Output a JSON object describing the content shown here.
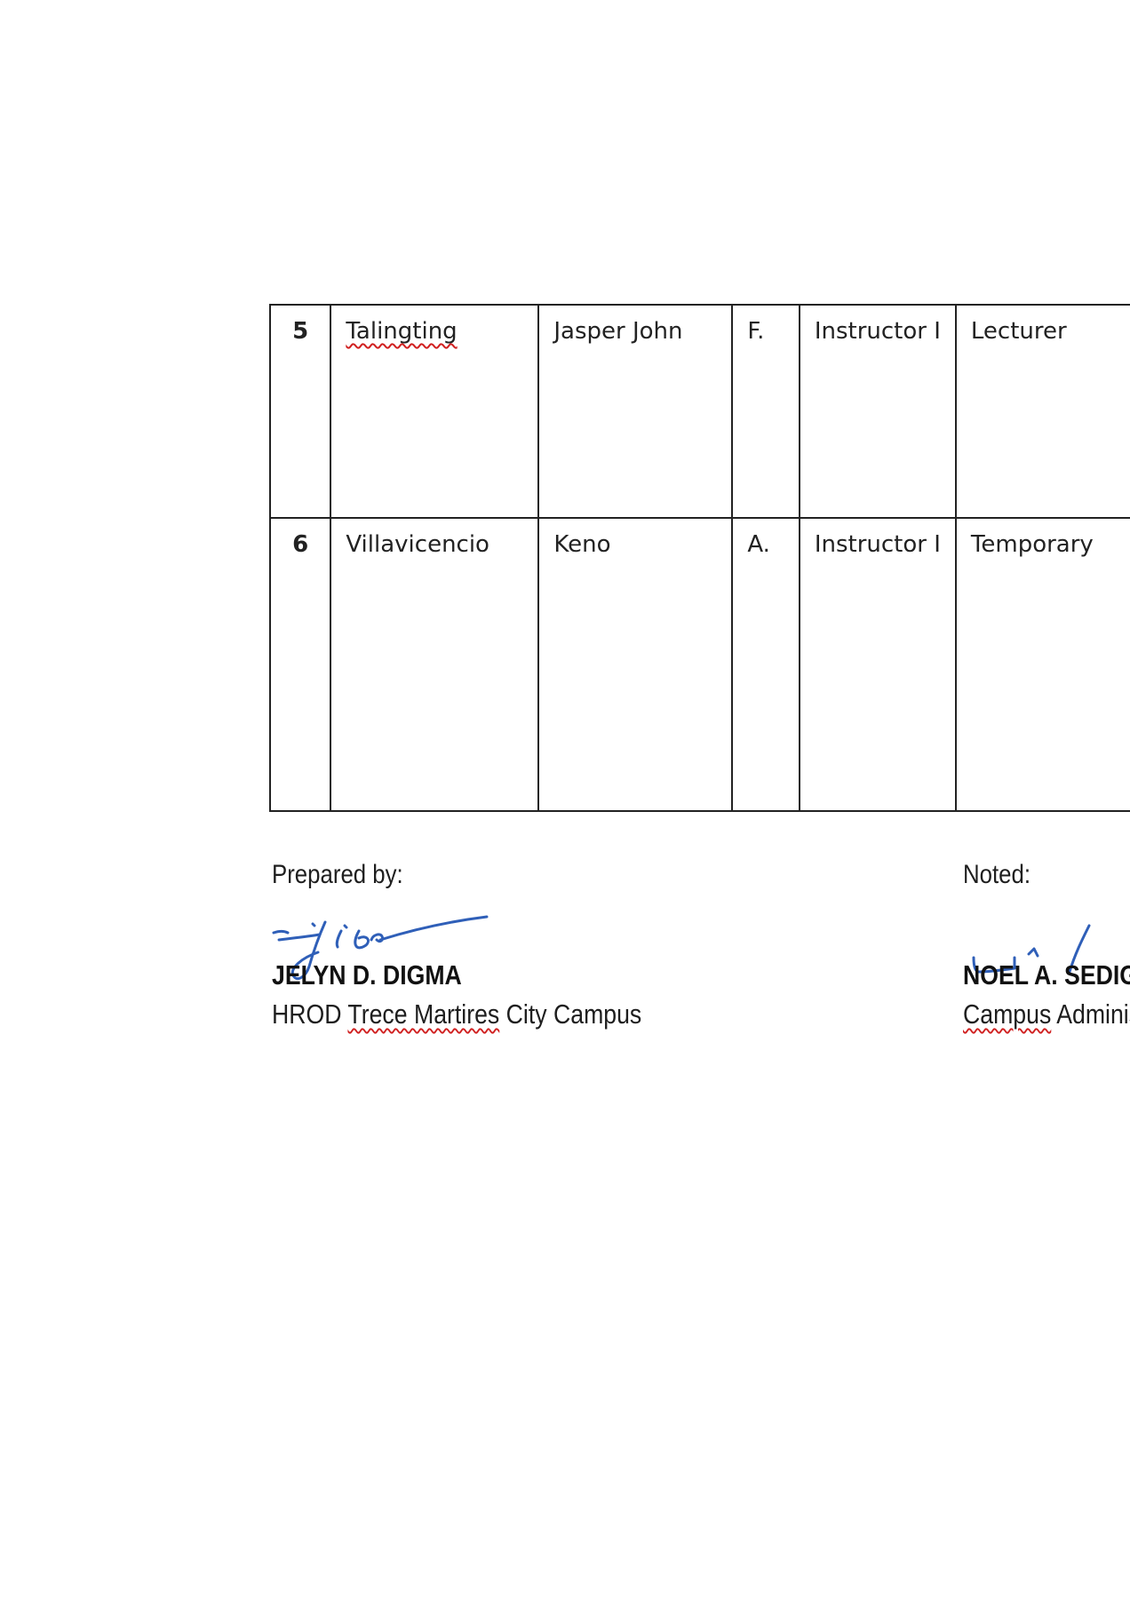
{
  "table": {
    "rows": [
      {
        "no": "5",
        "last_name": "Talingting",
        "first_name": "Jasper John",
        "middle_initial": "F.",
        "position": "Instructor I",
        "status": "Lecturer"
      },
      {
        "no": "6",
        "last_name": "Villavicencio",
        "first_name": "Keno",
        "middle_initial": "A.",
        "position": "Instructor I",
        "status": "Temporary"
      }
    ]
  },
  "signatories": {
    "prepared": {
      "label": "Prepared by:",
      "name": "JELYN D. DIGMA",
      "title_prefix": "HROD ",
      "title_underlined": "Trece Martires",
      "title_suffix": " City Campus"
    },
    "noted": {
      "label": "Noted:",
      "name": "NOEL A. SEDIG",
      "title_underlined": "Campus",
      "title_suffix": " Administrator"
    }
  },
  "colors": {
    "ink": "#2f5fb8",
    "border": "#222222",
    "spellcheck": "#d01f1f"
  }
}
